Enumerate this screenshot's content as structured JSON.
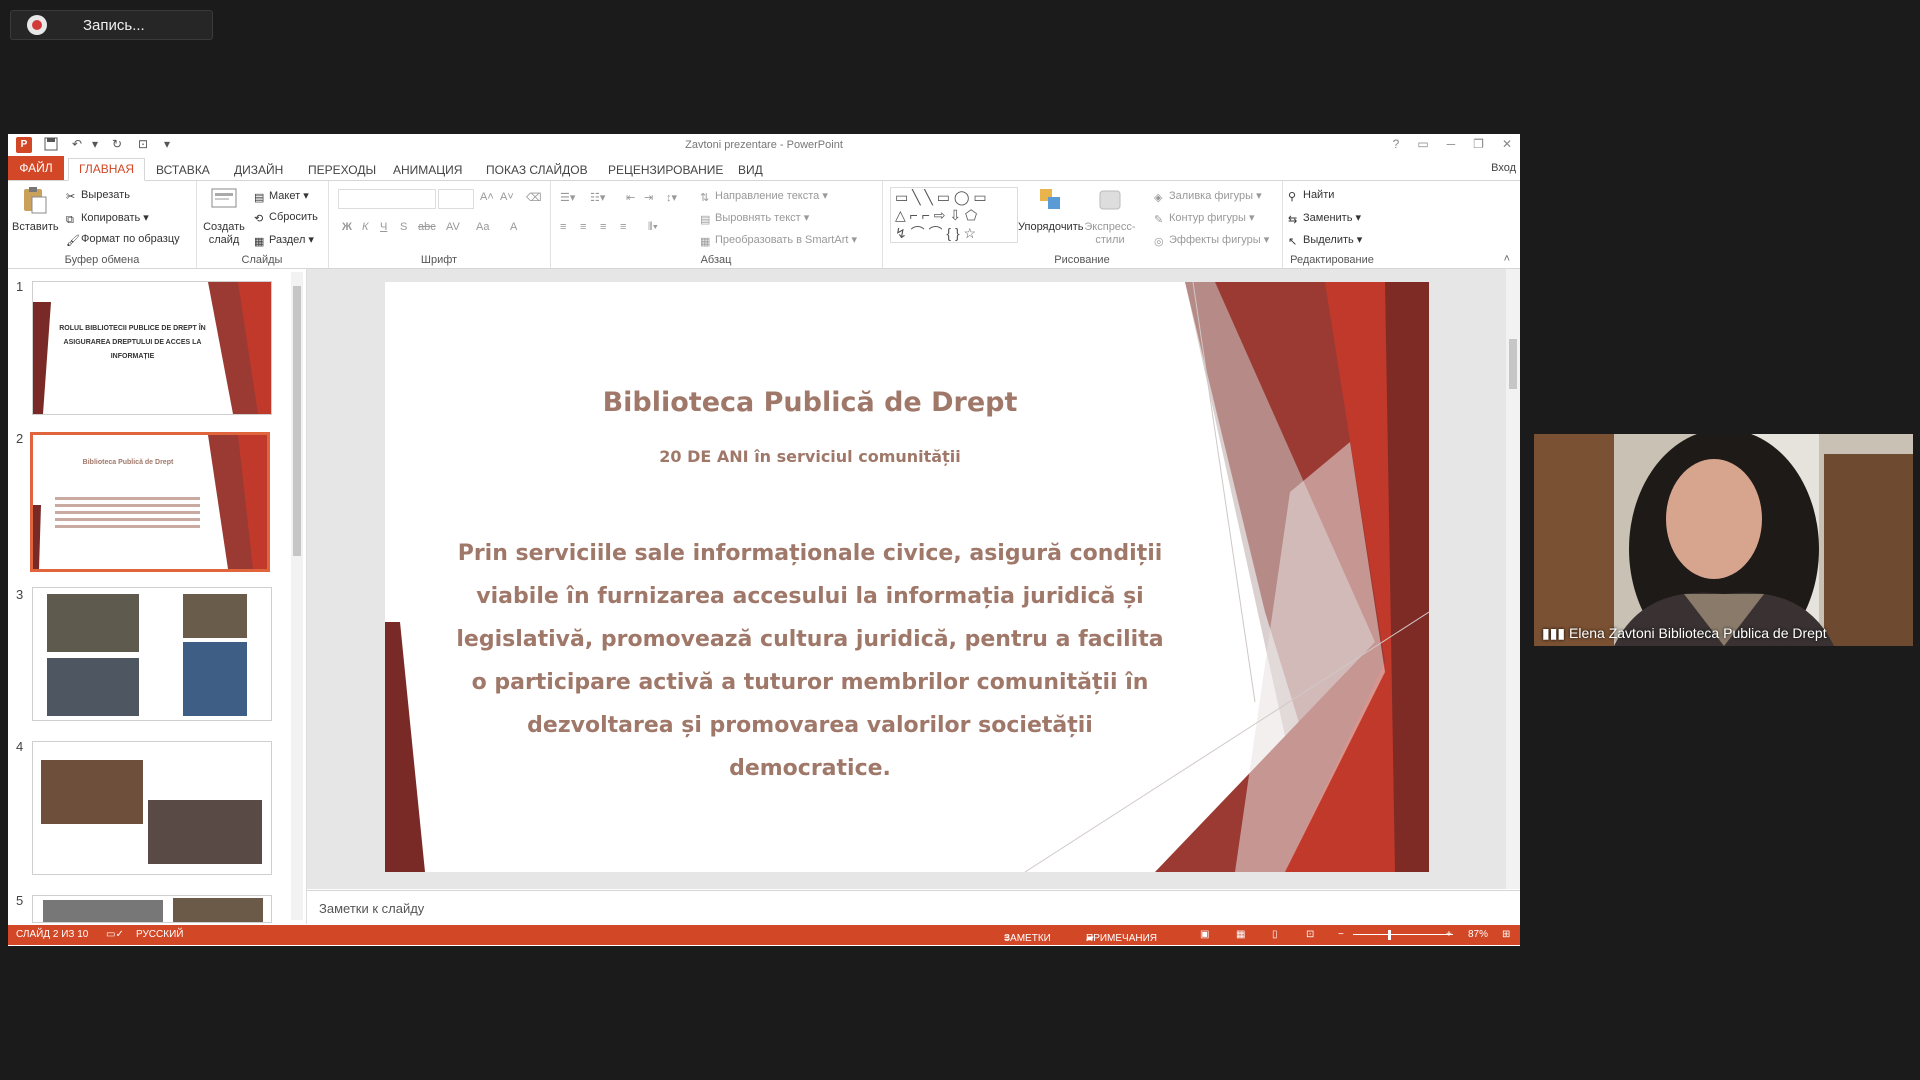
{
  "recording": {
    "label": "Запись..."
  },
  "window": {
    "title": "Zavtoni prezentare - PowerPoint",
    "login": "Вход"
  },
  "tabs": [
    "ФАЙЛ",
    "ГЛАВНАЯ",
    "ВСТАВКА",
    "ДИЗАЙН",
    "ПЕРЕХОДЫ",
    "АНИМАЦИЯ",
    "ПОКАЗ СЛАЙДОВ",
    "РЕЦЕНЗИРОВАНИЕ",
    "ВИД"
  ],
  "ribbon": {
    "clipboard": {
      "paste": "Вставить",
      "cut": "Вырезать",
      "copy": "Копировать",
      "format_painter": "Формат по образцу",
      "label": "Буфер обмена"
    },
    "slides": {
      "new_slide": "Создать слайд",
      "layout": "Макет",
      "reset": "Сбросить",
      "section": "Раздел",
      "label": "Слайды"
    },
    "font": {
      "label": "Шрифт"
    },
    "paragraph": {
      "text_direction": "Направление текста",
      "align_text": "Выровнять текст",
      "smartart": "Преобразовать в SmartArt",
      "label": "Абзац"
    },
    "drawing": {
      "arrange": "Упорядочить",
      "quick_styles": "Экспресс-стили",
      "shape_fill": "Заливка фигуры",
      "shape_outline": "Контур фигуры",
      "shape_effects": "Эффекты фигуры",
      "label": "Рисование"
    },
    "editing": {
      "find": "Найти",
      "replace": "Заменить",
      "select": "Выделить",
      "label": "Редактирование"
    }
  },
  "thumbnails": [
    {
      "num": "1",
      "title": "ROLUL BIBLIOTECII PUBLICE DE DREPT ÎN ASIGURAREA DREPTULUI DE ACCES LA INFORMAȚIE"
    },
    {
      "num": "2",
      "title": "Biblioteca Publică de Drept"
    },
    {
      "num": "3",
      "title": ""
    },
    {
      "num": "4",
      "title": ""
    },
    {
      "num": "5",
      "title": ""
    }
  ],
  "slide": {
    "title": "Biblioteca Publică de Drept",
    "subtitle": "20 DE ANI în serviciul comunității",
    "body": "Prin serviciile sale informaționale civice, asigură condiții viabile în furnizarea accesului la informația juridică și legislativă, promovează cultura juridică, pentru a facilita o participare activă a tuturor membrilor comunității în dezvoltarea și promovarea valorilor societății democratice."
  },
  "notes_placeholder": "Заметки к слайду",
  "status": {
    "slide_info": "СЛАЙД 2 ИЗ 10",
    "language": "РУССКИЙ",
    "notes": "ЗАМЕТКИ",
    "comments": "ПРИМЕЧАНИЯ",
    "zoom": "87%"
  },
  "participant": {
    "name": "Elena Zavtoni Biblioteca Publica de Drept"
  },
  "colors": {
    "accent": "#d24726",
    "slide_text": "#a0786a",
    "dark_red": "#7a2a26"
  }
}
